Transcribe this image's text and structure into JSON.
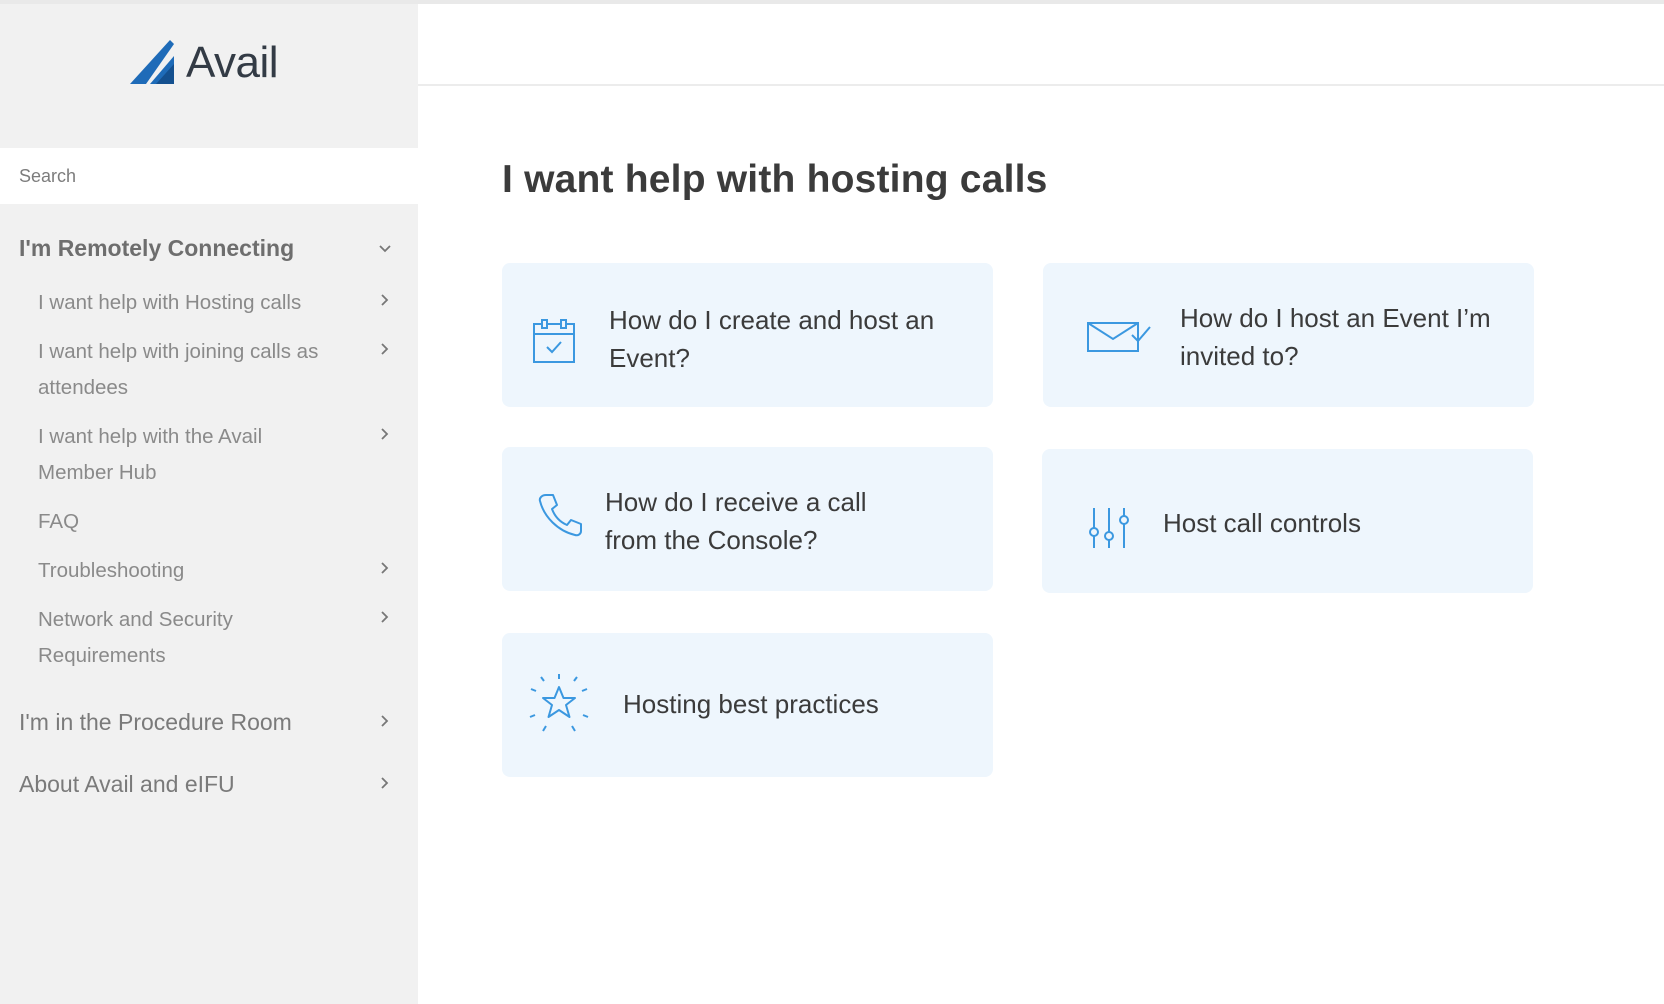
{
  "brand": {
    "name": "Avail",
    "accent": "#1e6bb8"
  },
  "search": {
    "placeholder": "Search"
  },
  "nav": {
    "section1": {
      "label": "I'm Remotely Connecting"
    },
    "sub": [
      {
        "label": "I want help with Hosting calls"
      },
      {
        "label": "I want help with joining calls as attendees"
      },
      {
        "label": "I want help with the Avail Member Hub"
      },
      {
        "label": "FAQ"
      },
      {
        "label": "Troubleshooting"
      },
      {
        "label": "Network and Security Requirements"
      }
    ],
    "section2": {
      "label": "I'm in the Procedure Room"
    },
    "section3": {
      "label": "About Avail and eIFU"
    }
  },
  "main": {
    "title": "I want help with hosting calls",
    "cards": [
      {
        "label": "How do I create and host an Event?",
        "icon": "calendar-check-icon"
      },
      {
        "label": "How do I host an Event I’m invited to?",
        "icon": "envelope-check-icon"
      },
      {
        "label": "How do I receive a call from the Console?",
        "icon": "phone-icon"
      },
      {
        "label": "Host call controls",
        "icon": "sliders-icon"
      },
      {
        "label": "Hosting best practices",
        "icon": "star-sparkle-icon"
      }
    ]
  },
  "colors": {
    "icon_blue": "#3b98e0",
    "card_bg": "#eef6fd",
    "sidebar_bg": "#f1f1f1"
  }
}
